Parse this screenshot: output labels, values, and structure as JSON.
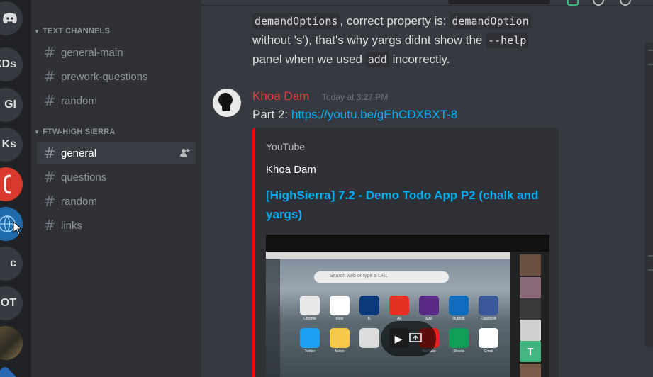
{
  "servers": [
    {
      "name": "discord-home-icon",
      "label": ""
    },
    {
      "name": "server-xds",
      "label": "XDs"
    },
    {
      "name": "server-gi",
      "label": "GI"
    },
    {
      "name": "server-ks",
      "label": "Ks"
    },
    {
      "name": "server-red",
      "label": ""
    },
    {
      "name": "server-globe",
      "label": ""
    },
    {
      "name": "server-c",
      "label": "c"
    },
    {
      "name": "server-iot",
      "label": "iOT"
    },
    {
      "name": "server-photo",
      "label": ""
    }
  ],
  "sidebar": {
    "categories": [
      {
        "label": "TEXT CHANNELS"
      },
      {
        "label": "FTW-HIGH SIERRA"
      }
    ],
    "text_channels": [
      "general-main",
      "prework-questions",
      "random"
    ],
    "sierra_channels": [
      "general",
      "questions",
      "random",
      "links"
    ],
    "active_channel": "general"
  },
  "messages": {
    "prev": {
      "line1_code_a": "demandOptions",
      "line1_text": ", correct property is:",
      "line1_code_b": "demandOption",
      "line2_text": "without 's'), that's why yargs didnt show the",
      "line2_code": "--help",
      "line3_a": "panel when we used",
      "line3_code": "add",
      "line3_b": "incorrectly."
    },
    "current": {
      "author": "Khoa Dam",
      "timestamp": "Today at 3:27 PM",
      "text_prefix": "Part 2:",
      "link": "https://youtu.be/gEhCDXBXT-8"
    }
  },
  "embed": {
    "provider": "YouTube",
    "author": "Khoa Dam",
    "title": "[HighSierra] 7.2 - Demo Todo App P2 (chalk and yargs)",
    "accent_color": "#ff0000",
    "thumbnail": {
      "search_placeholder": "Search web or type a URL",
      "camera_initial": "T",
      "tiles": [
        {
          "label": "Chrome",
          "color": "#e8e8e8"
        },
        {
          "label": "ebay",
          "color": "#ffffff"
        },
        {
          "label": "B.",
          "color": "#0a3a7a"
        },
        {
          "label": "Ali",
          "color": "#e43225"
        },
        {
          "label": "Mail",
          "color": "#5b2a86"
        },
        {
          "label": "Outlook",
          "color": "#0f6cbd"
        },
        {
          "label": "Facebook",
          "color": "#3b5998"
        },
        {
          "label": "Twitter",
          "color": "#1da1f2"
        },
        {
          "label": "Notes",
          "color": "#f7c948"
        },
        {
          "label": "",
          "color": "#dddddd"
        },
        {
          "label": "",
          "color": "#444444"
        },
        {
          "label": "YouTube",
          "color": "#e62117"
        },
        {
          "label": "Sheets",
          "color": "#0f9d58"
        },
        {
          "label": "Gmail",
          "color": "#ffffff"
        }
      ]
    }
  },
  "colors": {
    "author_red": "#e03c3c",
    "link_blue": "#00b0f4"
  }
}
